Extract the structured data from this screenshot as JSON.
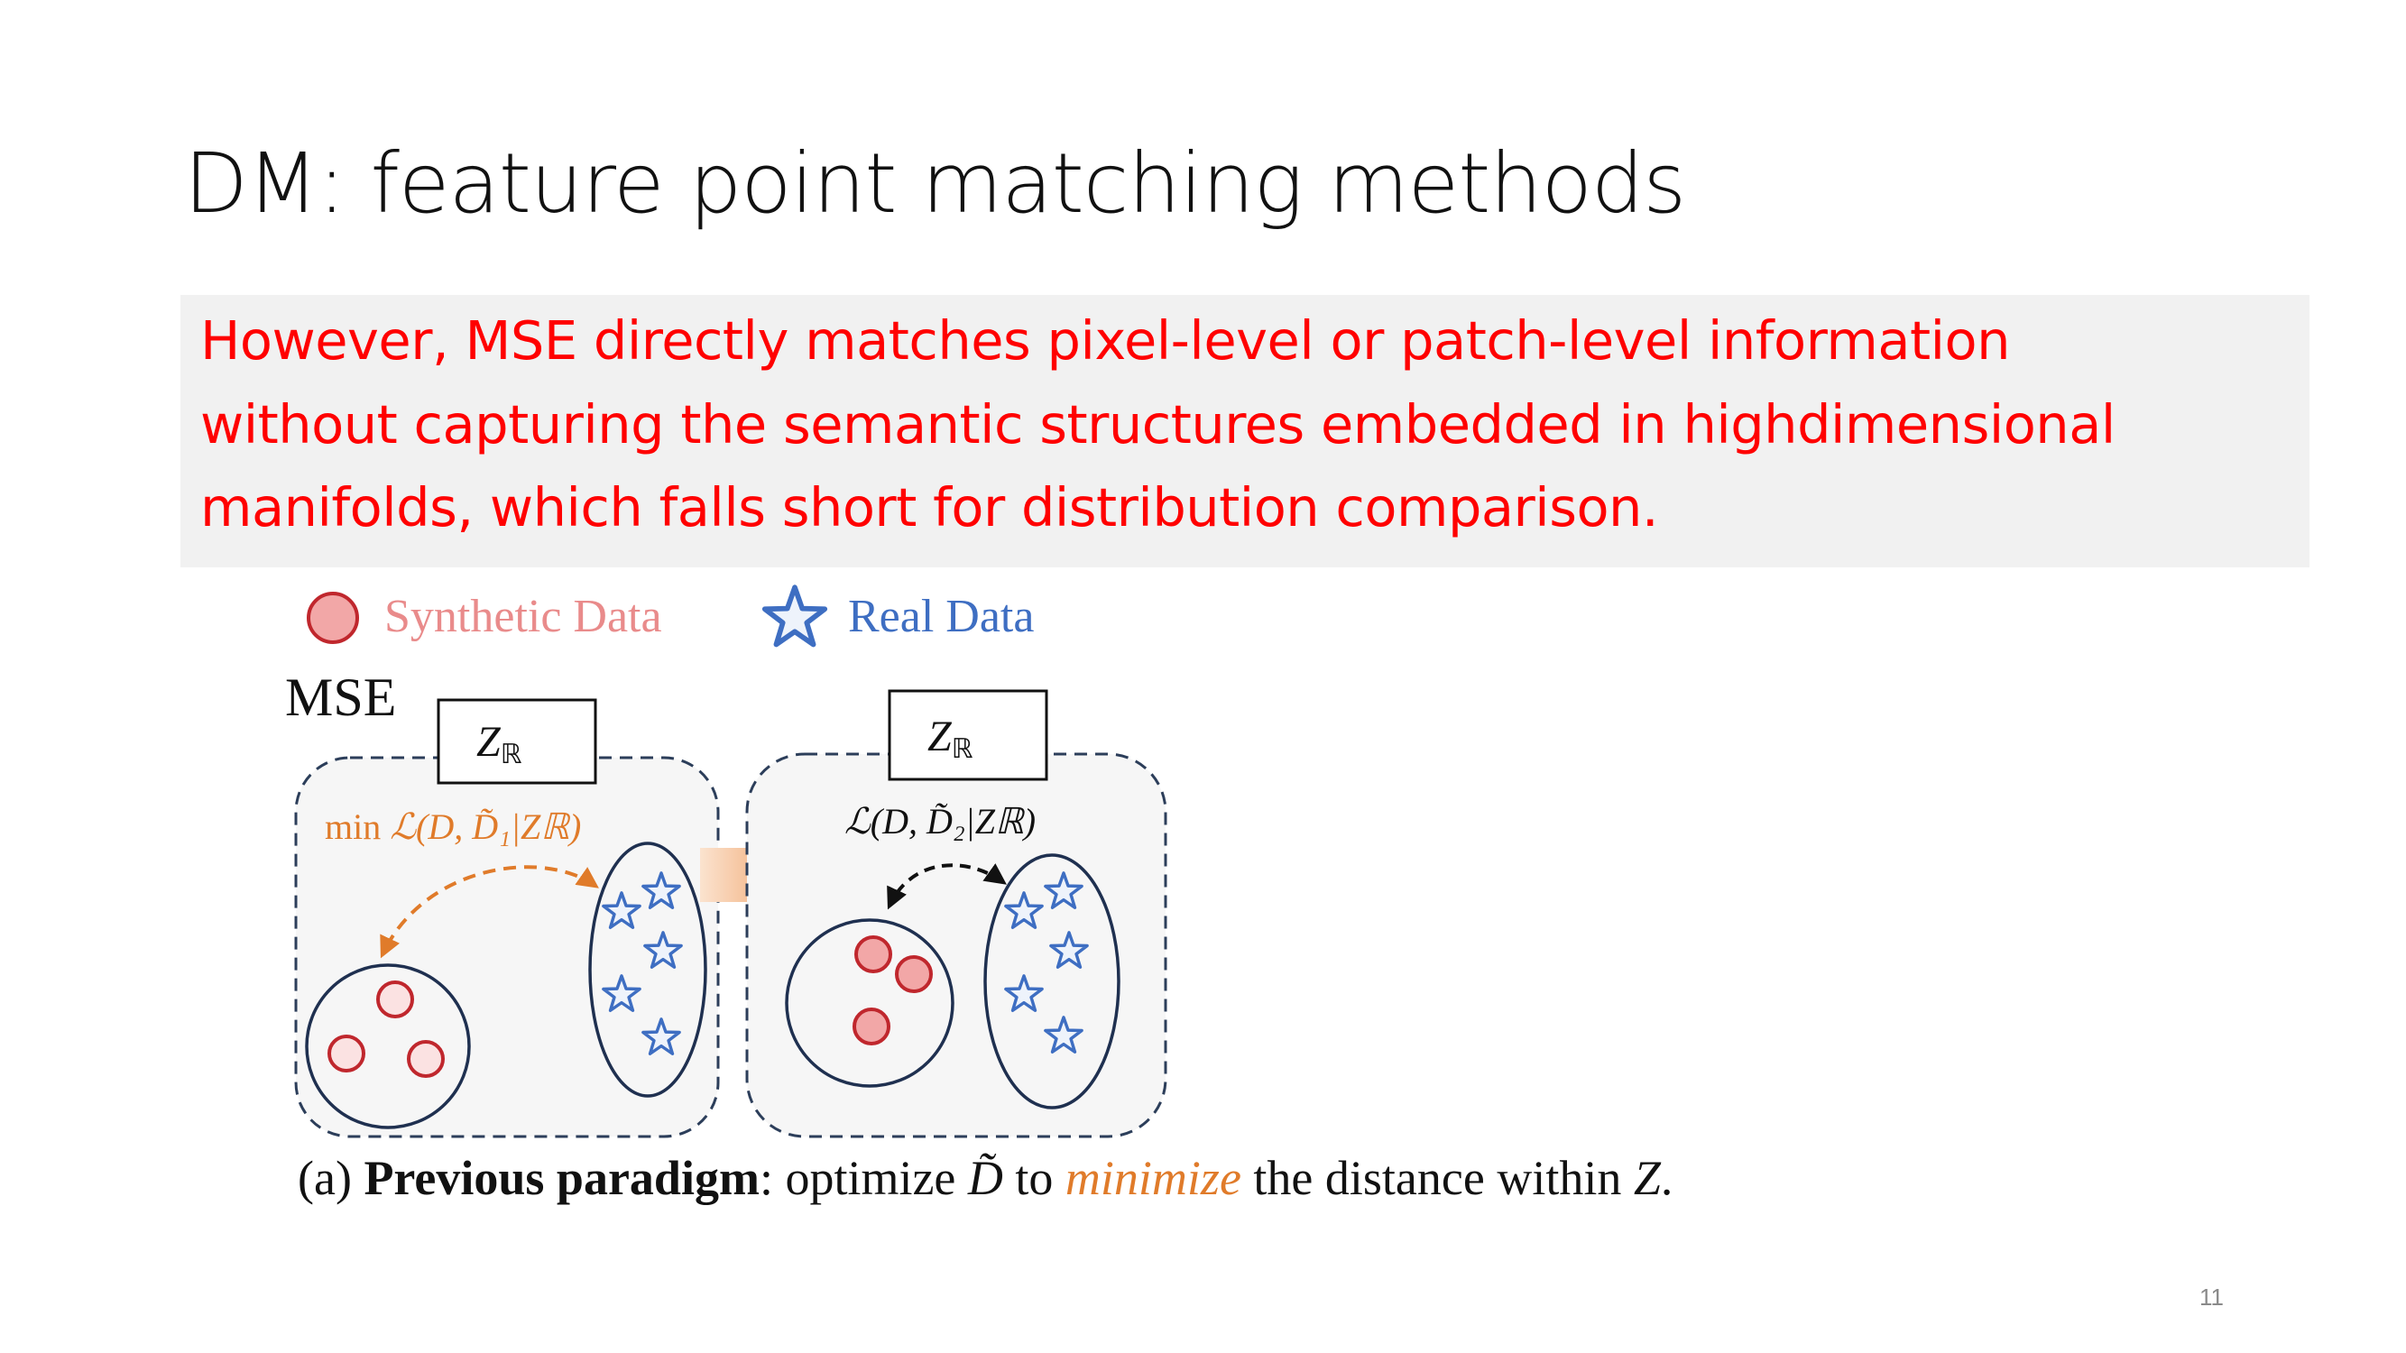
{
  "slide": {
    "title": "DM: feature point matching methods",
    "page_number": "11"
  },
  "callout": {
    "lines": [
      "However, MSE directly matches pixel-level or patch-level information",
      "without capturing the semantic structures embedded in highdimensional",
      "manifolds, which falls short for distribution comparison."
    ],
    "text_color": "#ff0000",
    "background": "#f1f1f1"
  },
  "figure": {
    "legend": {
      "synthetic": "Synthetic Data",
      "real": "Real Data"
    },
    "method_label": "MSE",
    "space_label": "Z",
    "space_subscript": "ℝ",
    "left_loss": {
      "prefix": "min ",
      "expr": "ℒ(D, D̃₁|Zℝ)"
    },
    "right_loss": {
      "expr": "ℒ(D, D̃₂|Zℝ)"
    },
    "caption": {
      "tag": "(a) ",
      "bold": "Previous paradigm",
      "text1": ": optimize ",
      "symbol_d": "D̃",
      "text2": " to ",
      "highlight": "minimize",
      "text3": " the distance within ",
      "symbol_z": "Z",
      "text4": "."
    },
    "colors": {
      "synthetic": "#c0272d",
      "synthetic_fill": "#f2a7a7",
      "real": "#3e6ec2",
      "orange": "#e07b2a",
      "dash_border": "#2c3e5a"
    }
  }
}
